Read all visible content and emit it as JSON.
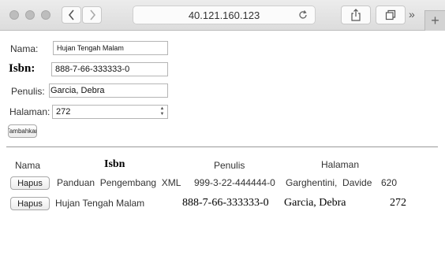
{
  "browser": {
    "url": "40.121.160.123"
  },
  "form": {
    "nama_label": "Nama:",
    "nama_value": "Hujan Tengah Malam",
    "isbn_label": "Isbn:",
    "isbn_value": "888-7-66-333333-0",
    "penulis_label": "Penulis:",
    "penulis_value": "Garcia, Debra",
    "halaman_label": "Halaman:",
    "halaman_value": "272",
    "submit_label": "Tambahkan"
  },
  "table": {
    "headers": {
      "nama": "Nama",
      "isbn": "Isbn",
      "penulis": "Penulis",
      "halaman": "Halaman"
    },
    "rows": [
      {
        "delete_label": "Hapus",
        "nama": "Panduan  Pengembang  XML",
        "isbn": "999-3-22-444444-0",
        "penulis": "Garghentini,  Davide",
        "halaman": "620"
      },
      {
        "delete_label": "Hapus",
        "nama": "Hujan Tengah Malam",
        "isbn": "888-7-66-333333-0",
        "penulis": "Garcia, Debra",
        "halaman": "272"
      }
    ]
  }
}
